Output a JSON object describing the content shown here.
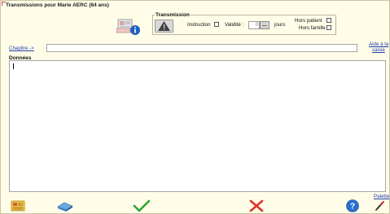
{
  "window": {
    "title": "Transmissions pour  Marie AERC (84 ans)"
  },
  "transmission": {
    "group_label": "Transmission",
    "instruction_label": "Instruction",
    "instruction_checked": false,
    "validite_label": "Validité :",
    "validite_value": "0",
    "jours_label": "jours",
    "hors_patient_label": "Hors patient",
    "hors_patient_checked": false,
    "hors_famille_label": "Hors famille",
    "hors_famille_checked": false
  },
  "chapitre": {
    "link_label": "Chapitre ->",
    "value": ""
  },
  "aide": {
    "line1": "Aide à la",
    "line2": "saisie"
  },
  "donnees": {
    "label": "Données",
    "value": ""
  },
  "palette_label": "Palette",
  "icons": {
    "patient": "patient-card-info-icon",
    "warning": "warning-triangle-icon",
    "card": "card-list-icon",
    "eraser": "eraser-icon",
    "validate": "green-check-icon",
    "cancel": "red-cross-icon",
    "help": "help-question-icon",
    "pen": "pen-icon"
  }
}
